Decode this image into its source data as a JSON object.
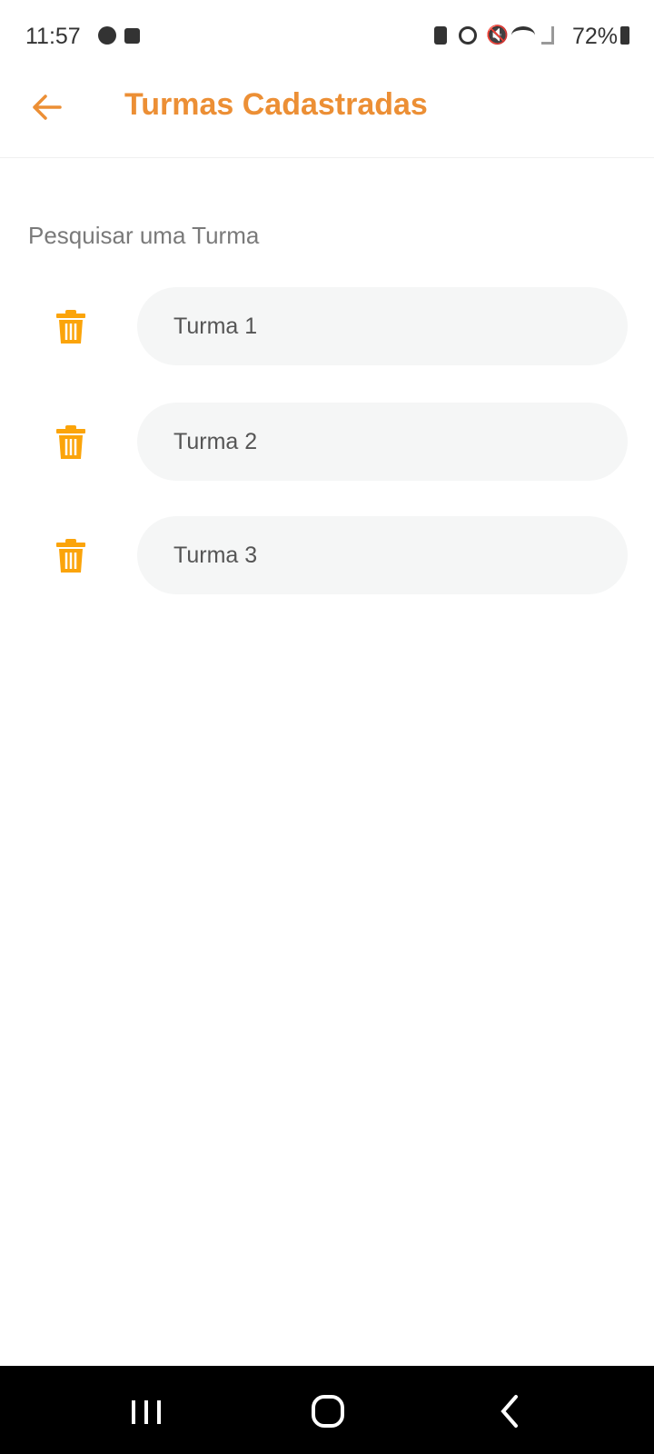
{
  "status_bar": {
    "time": "11:57",
    "battery": "72%"
  },
  "header": {
    "title": "Turmas Cadastradas"
  },
  "search": {
    "label": "Pesquisar uma Turma"
  },
  "turmas": [
    {
      "name": "Turma 1"
    },
    {
      "name": "Turma 2"
    },
    {
      "name": "Turma 3"
    }
  ],
  "colors": {
    "accent": "#ec8f35",
    "trash": "#fba40a",
    "pill": "#f5f6f6"
  }
}
